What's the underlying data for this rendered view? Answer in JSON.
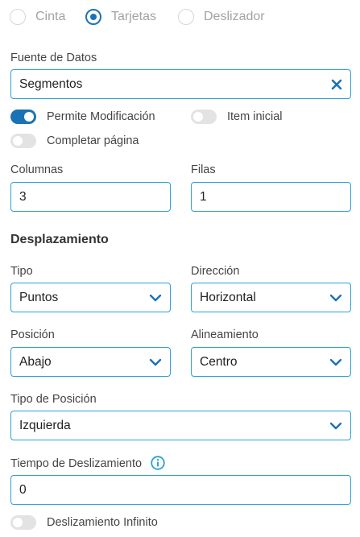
{
  "display_mode": {
    "options": [
      {
        "label": "Cinta",
        "selected": false
      },
      {
        "label": "Tarjetas",
        "selected": true
      },
      {
        "label": "Deslizador",
        "selected": false
      }
    ]
  },
  "data_source": {
    "label": "Fuente de Datos",
    "value": "Segmentos",
    "clear_icon": "close-icon"
  },
  "toggles": {
    "allow_modification": {
      "label": "Permite Modificación",
      "on": true
    },
    "initial_item": {
      "label": "Item inicial",
      "on": false
    },
    "fill_page": {
      "label": "Completar página",
      "on": false
    },
    "infinite_scroll": {
      "label": "Deslizamiento Infinito",
      "on": false
    }
  },
  "grid": {
    "columns_label": "Columnas",
    "columns_value": "3",
    "rows_label": "Filas",
    "rows_value": "1"
  },
  "scroll_section": {
    "title": "Desplazamiento",
    "type_label": "Tipo",
    "type_value": "Puntos",
    "direction_label": "Dirección",
    "direction_value": "Horizontal",
    "position_label": "Posición",
    "position_value": "Abajo",
    "alignment_label": "Alineamiento",
    "alignment_value": "Centro",
    "position_type_label": "Tipo de Posición",
    "position_type_value": "Izquierda",
    "scroll_time_label": "Tiempo de Deslizamiento",
    "scroll_time_value": "0",
    "info_icon": "info-icon"
  },
  "colors": {
    "accent": "#1a73b5",
    "field_border": "#2aa1d6",
    "toggle_off": "#e3e3e3",
    "radio_unselected_text": "#a3a3a3"
  }
}
